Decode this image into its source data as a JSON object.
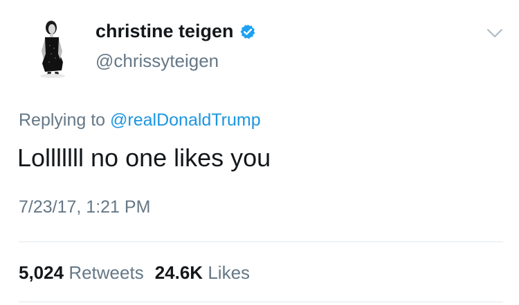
{
  "author": {
    "name": "christine teigen",
    "handle": "@chrissyteigen",
    "verified": true,
    "avatar_icon": "profile-photo-icon",
    "verified_icon": "verified-badge-icon"
  },
  "menu_icon": "chevron-down-icon",
  "reply": {
    "prefix": "Replying to",
    "mention": "@realDonaldTrump"
  },
  "tweet": {
    "text": "Lolllllll no one likes you",
    "timestamp": "7/23/17, 1:21 PM"
  },
  "stats": {
    "retweets_count": "5,024",
    "retweets_label": "Retweets",
    "likes_count": "24.6K",
    "likes_label": "Likes"
  },
  "colors": {
    "text": "#14171a",
    "secondary": "#657786",
    "link": "#1b95e0",
    "divider": "#e1e8ed"
  }
}
